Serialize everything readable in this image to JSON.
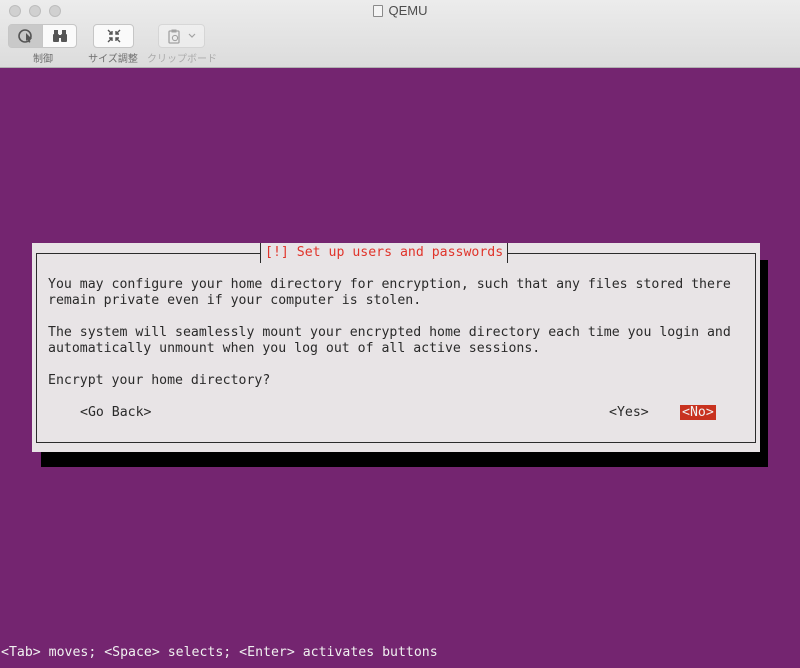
{
  "window": {
    "title": "QEMU"
  },
  "toolbar": {
    "control_label": "制御",
    "resize_label": "サイズ調整",
    "clipboard_label": "クリップボード"
  },
  "dialog": {
    "title": "[!] Set up users and passwords",
    "line1": "You may configure your home directory for encryption, such that any files stored there",
    "line2": "remain private even if your computer is stolen.",
    "line3": "The system will seamlessly mount your encrypted home directory each time you login and",
    "line4": "automatically unmount when you log out of all active sessions.",
    "question": "Encrypt your home directory?",
    "go_back": "<Go Back>",
    "yes": "<Yes>",
    "no": "<No>"
  },
  "statusbar": {
    "text": "<Tab> moves; <Space> selects; <Enter> activates buttons"
  },
  "colors": {
    "background": "#742570",
    "dialog": "#e8e4e6",
    "title_text": "#e0342b",
    "selected_button": "#c8321f"
  }
}
